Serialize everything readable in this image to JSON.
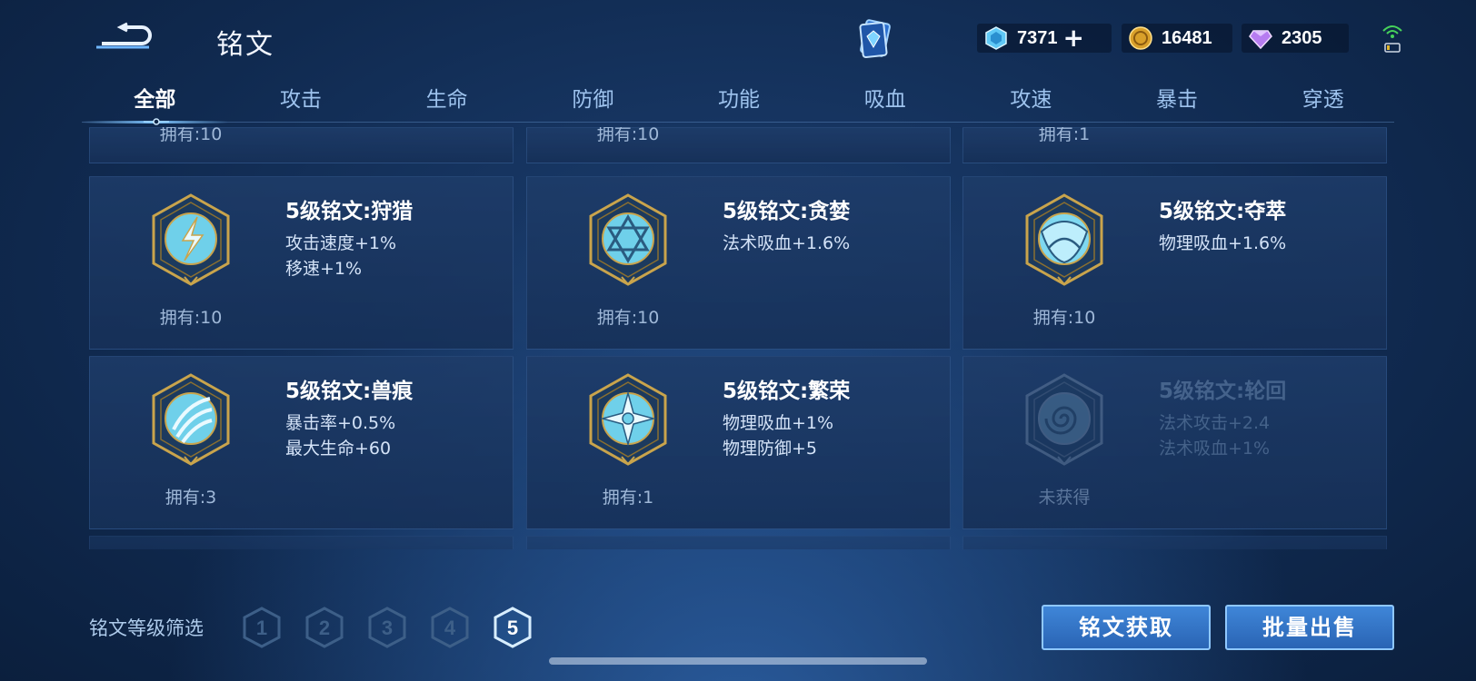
{
  "header": {
    "title": "铭文",
    "currencies": [
      {
        "icon": "diamond-coupon-icon",
        "value": "7371"
      },
      {
        "icon": "gold-coin-icon",
        "value": "16481"
      },
      {
        "icon": "gem-icon",
        "value": "2305"
      }
    ]
  },
  "tabs": [
    "全部",
    "攻击",
    "生命",
    "防御",
    "功能",
    "吸血",
    "攻速",
    "暴击",
    "穿透"
  ],
  "active_tab": "全部",
  "partial_row": [
    "拥有:10",
    "拥有:10",
    "拥有:1"
  ],
  "cards": [
    {
      "name": "5级铭文:狩猎",
      "attrs": [
        "攻击速度+1%",
        "移速+1%"
      ],
      "own": "拥有:10",
      "icon": "lightning-emblem-icon"
    },
    {
      "name": "5级铭文:贪婪",
      "attrs": [
        "法术吸血+1.6%"
      ],
      "own": "拥有:10",
      "icon": "star-of-david-emblem-icon"
    },
    {
      "name": "5级铭文:夺萃",
      "attrs": [
        "物理吸血+1.6%"
      ],
      "own": "拥有:10",
      "icon": "triquetra-emblem-icon"
    },
    {
      "name": "5级铭文:兽痕",
      "attrs": [
        "暴击率+0.5%",
        "最大生命+60"
      ],
      "own": "拥有:3",
      "icon": "claw-mark-emblem-icon"
    },
    {
      "name": "5级铭文:繁荣",
      "attrs": [
        "物理吸血+1%",
        "物理防御+5"
      ],
      "own": "拥有:1",
      "icon": "snowflake-emblem-icon"
    },
    {
      "name": "5级铭文:轮回",
      "attrs": [
        "法术攻击+2.4",
        "法术吸血+1%"
      ],
      "own": "未获得",
      "icon": "spiral-emblem-icon"
    }
  ],
  "filter": {
    "label": "铭文等级筛选",
    "levels": [
      "1",
      "2",
      "3",
      "4",
      "5"
    ],
    "selected": "5"
  },
  "buttons": {
    "acquire": "铭文获取",
    "sell": "批量出售"
  },
  "colors": {
    "accent": "#7cc6ff",
    "gold_frame": "#c9a44c",
    "button": "#2f72c4"
  }
}
